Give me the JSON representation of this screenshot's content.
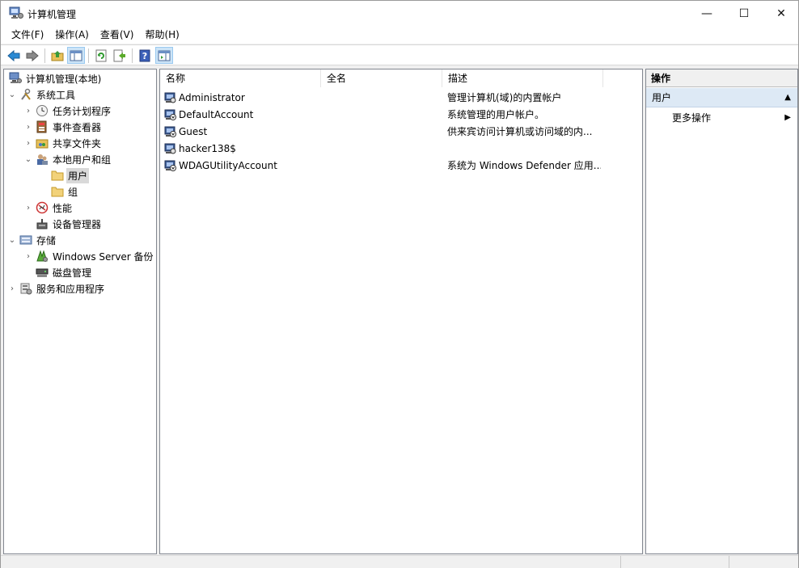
{
  "window": {
    "title": "计算机管理",
    "minimize_glyph": "—",
    "maximize_glyph": "☐",
    "close_glyph": "✕"
  },
  "menu": [
    "文件(F)",
    "操作(A)",
    "查看(V)",
    "帮助(H)"
  ],
  "toolbar": {
    "icons": [
      "back-arrow-icon",
      "forward-arrow-icon",
      "up-folder-icon",
      "show-hide-tree-icon",
      "refresh-icon",
      "export-list-icon",
      "help-icon",
      "show-hide-action-pane-icon"
    ]
  },
  "tree": {
    "root": "计算机管理(本地)",
    "system_tools": "系统工具",
    "task_scheduler": "任务计划程序",
    "event_viewer": "事件查看器",
    "shared_folders": "共享文件夹",
    "local_users_groups": "本地用户和组",
    "users": "用户",
    "groups": "组",
    "performance": "性能",
    "device_manager": "设备管理器",
    "storage": "存储",
    "windows_server_backup": "Windows Server 备份",
    "disk_management": "磁盘管理",
    "services_apps": "服务和应用程序"
  },
  "list": {
    "columns": {
      "name": "名称",
      "fullname": "全名",
      "description": "描述"
    },
    "rows": [
      {
        "name": "Administrator",
        "fullname": "",
        "description": "管理计算机(域)的内置帐户"
      },
      {
        "name": "DefaultAccount",
        "fullname": "",
        "description": "系统管理的用户帐户。"
      },
      {
        "name": "Guest",
        "fullname": "",
        "description": "供来宾访问计算机或访问域的内..."
      },
      {
        "name": "hacker138$",
        "fullname": "",
        "description": ""
      },
      {
        "name": "WDAGUtilityAccount",
        "fullname": "",
        "description": "系统为 Windows Defender 应用..."
      }
    ]
  },
  "actions": {
    "header": "操作",
    "section": "用户",
    "more_actions": "更多操作"
  },
  "colors": {
    "selection": "#d9d9d9",
    "action_section_bg": "#dde9f5",
    "toolbar_pressed": "#cce4f7"
  }
}
